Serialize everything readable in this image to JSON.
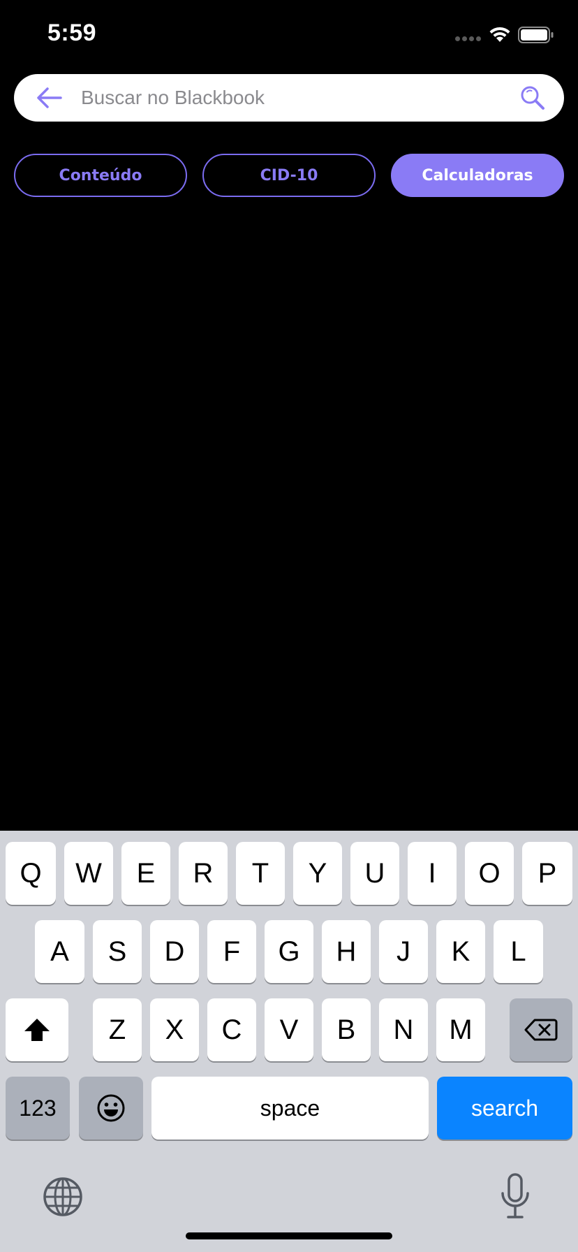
{
  "status_bar": {
    "time": "5:59"
  },
  "search": {
    "placeholder": "Buscar no Blackbook",
    "value": ""
  },
  "tabs": [
    {
      "label": "Conteúdo",
      "active": false
    },
    {
      "label": "CID-10",
      "active": false
    },
    {
      "label": "Calculadoras",
      "active": true
    }
  ],
  "keyboard": {
    "row1": [
      "Q",
      "W",
      "E",
      "R",
      "T",
      "Y",
      "U",
      "I",
      "O",
      "P"
    ],
    "row2": [
      "A",
      "S",
      "D",
      "F",
      "G",
      "H",
      "J",
      "K",
      "L"
    ],
    "row3": [
      "Z",
      "X",
      "C",
      "V",
      "B",
      "N",
      "M"
    ],
    "numbers_label": "123",
    "space_label": "space",
    "return_label": "search"
  },
  "colors": {
    "accent": "#8a7bf5",
    "background": "#000000",
    "keyboard_bg": "#d1d3d9",
    "return_key": "#0a84ff"
  },
  "icons": [
    "back-arrow-icon",
    "search-icon",
    "wifi-icon",
    "battery-icon",
    "shift-icon",
    "delete-icon",
    "emoji-icon",
    "globe-icon",
    "microphone-icon"
  ]
}
